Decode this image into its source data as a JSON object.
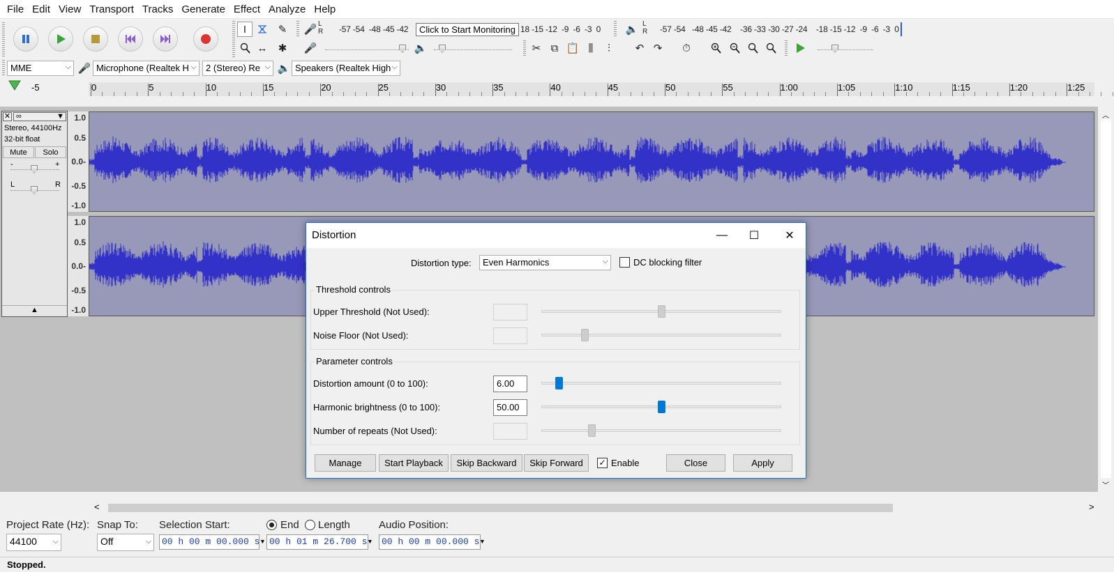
{
  "menu": [
    "File",
    "Edit",
    "View",
    "Transport",
    "Tracks",
    "Generate",
    "Effect",
    "Analyze",
    "Help"
  ],
  "meters": {
    "record_scale": "-57 -54  -48 -45 -42",
    "record_scale_tail": "18 -15 -12  -9  -6  -3  0",
    "tooltip": "Click to Start Monitoring",
    "play_scale": "-57 -54   -48 -45 -42    -36 -33 -30 -27 -24    -18 -15 -12  -9  -6  -3  0",
    "record_lr": "L\nR",
    "play_lr": "L\nR"
  },
  "device": {
    "host": "MME",
    "input": "Microphone (Realtek H",
    "channels": "2 (Stereo) Re",
    "output": "Speakers (Realtek High"
  },
  "ruler": {
    "ticks": [
      "-5",
      "0",
      "5",
      "10",
      "15",
      "20",
      "25",
      "30",
      "35",
      "40",
      "45",
      "50",
      "55",
      "1:00",
      "1:05",
      "1:10",
      "1:15",
      "1:20",
      "1:25"
    ]
  },
  "track": {
    "name": "∞",
    "info1": "Stereo, 44100Hz",
    "info2": "32-bit float",
    "mute": "Mute",
    "solo": "Solo",
    "gain_minus": "-",
    "gain_plus": "+",
    "pan_l": "L",
    "pan_r": "R",
    "scale": [
      "1.0",
      "0.5",
      "0.0-",
      "-0.5",
      "-1.0"
    ]
  },
  "dialog": {
    "title": "Distortion",
    "type_label": "Distortion type:",
    "type_value": "Even Harmonics",
    "dc_label": "DC blocking filter",
    "dc_checked": false,
    "threshold_group": "Threshold controls",
    "upper_label": "Upper Threshold (Not Used):",
    "noise_label": "Noise Floor (Not Used):",
    "param_group": "Parameter controls",
    "amount_label": "Distortion amount (0 to 100):",
    "amount_value": "6.00",
    "brightness_label": "Harmonic brightness (0 to 100):",
    "brightness_value": "50.00",
    "repeats_label": "Number of repeats (Not Used):",
    "buttons": {
      "manage": "Manage",
      "start_playback": "Start Playback",
      "skip_backward": "Skip Backward",
      "skip_forward": "Skip Forward",
      "enable": "Enable",
      "close": "Close",
      "apply": "Apply"
    },
    "enable_checked": true
  },
  "selection": {
    "rate_label": "Project Rate (Hz):",
    "rate_value": "44100",
    "snap_label": "Snap To:",
    "snap_value": "Off",
    "start_label": "Selection Start:",
    "end_label": "End",
    "length_label": "Length",
    "start_time": "00 h 00 m 00.000 s",
    "end_time": "00 h 01 m 26.700 s",
    "audio_pos_label": "Audio Position:",
    "audio_pos": "00 h 00 m 00.000 s"
  },
  "status": "Stopped.",
  "colors": {
    "waveform": "#3232c8",
    "wave_bg": "#9898b8",
    "accent": "#0078d7"
  }
}
